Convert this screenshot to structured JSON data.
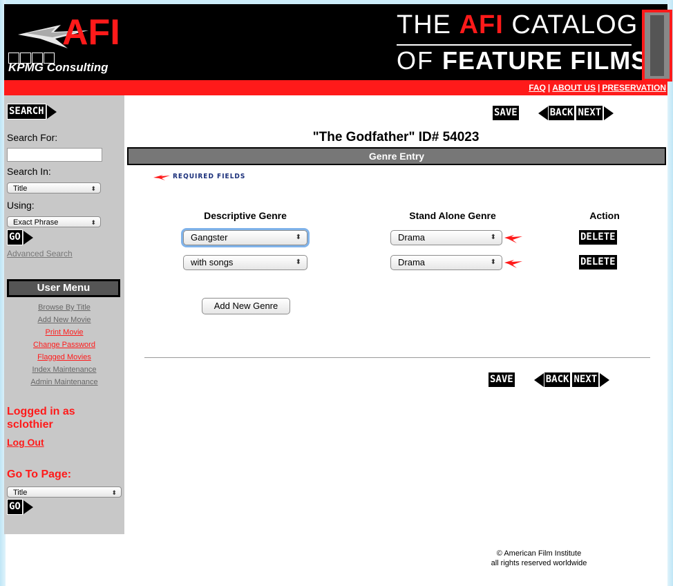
{
  "header": {
    "afi_logo": "AFI",
    "partner": "KPMG Consulting",
    "catalog_line1_pre": "THE ",
    "catalog_line1_afi": "AFI",
    "catalog_line1_post": " CATALOG",
    "catalog_line2_pre": "OF ",
    "catalog_line2_bold": "FEATURE FILMS",
    "links": [
      "FAQ",
      "ABOUT US",
      "PRESERVATION"
    ],
    "link_separator": "|"
  },
  "sidebar": {
    "search_button": "SEARCH",
    "search_for_label": "Search For:",
    "search_for_value": "",
    "search_in_label": "Search In:",
    "search_in_value": "Title",
    "using_label": "Using:",
    "using_value": "Exact Phrase",
    "go_button": "GO",
    "advanced_search": "Advanced Search",
    "user_menu_title": "User Menu",
    "menu_items": [
      {
        "label": "Browse By Title",
        "color": "#666666"
      },
      {
        "label": "Add New Movie",
        "color": "#666666"
      },
      {
        "label": "Print Movie",
        "color": "#ff1a1a"
      },
      {
        "label": "Change Password",
        "color": "#ff1a1a"
      },
      {
        "label": "Flagged Movies",
        "color": "#ff1a1a"
      },
      {
        "label": "Index Maintenance",
        "color": "#666666"
      },
      {
        "label": "Admin Maintenance",
        "color": "#666666"
      }
    ],
    "logged_in_line1": "Logged in as",
    "logged_in_user": "sclothier",
    "logout": "Log Out",
    "goto_label": "Go To Page:",
    "goto_value": "Title",
    "goto_button": "GO"
  },
  "main": {
    "title": "\"The Godfather\" ID# 54023",
    "section_bar": "Genre Entry",
    "required_fields": "REQUIRED FIELDS",
    "columns": {
      "descriptive": "Descriptive Genre",
      "stand_alone": "Stand Alone Genre",
      "action": "Action"
    },
    "rows": [
      {
        "descriptive": "Gangster",
        "stand_alone": "Drama",
        "action": "DELETE"
      },
      {
        "descriptive": "with songs",
        "stand_alone": "Drama",
        "action": "DELETE"
      }
    ],
    "add_button": "Add New Genre",
    "save": "SAVE",
    "back": "BACK",
    "next": "NEXT"
  },
  "footer": {
    "line1": "© American Film Institute",
    "line2": "all rights reserved worldwide"
  },
  "colors": {
    "brand_red": "#ff1a1a",
    "sidebar_gray": "#c8c8c8",
    "section_bar": "#777777",
    "required_blue": "#1a2f7a"
  }
}
